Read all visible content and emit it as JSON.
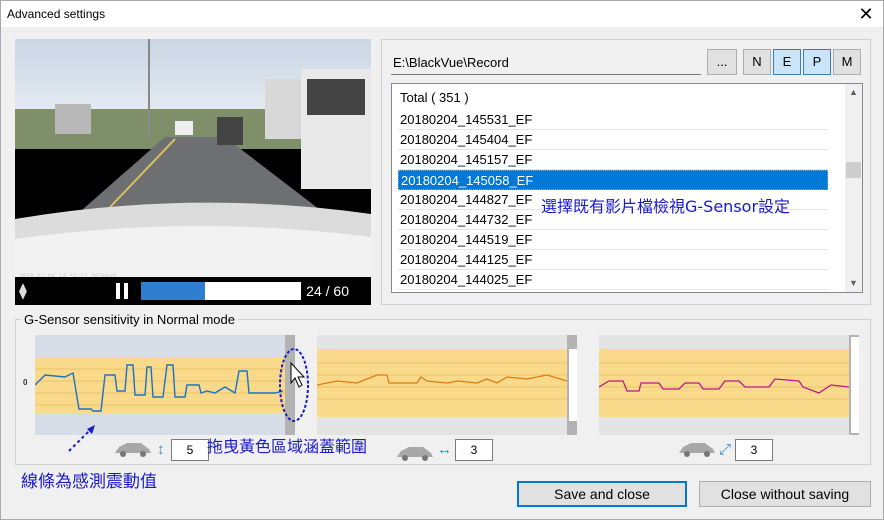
{
  "window": {
    "title": "Advanced settings",
    "close_glyph": "✕"
  },
  "video": {
    "counter": "24 / 60",
    "progress_fraction": 0.4,
    "timestamp_overlay": "2018-02-04 14:51:23  103km/h"
  },
  "toolbar": {
    "path_value": "E:\\BlackVue\\Record",
    "browse_label": "...",
    "filters": [
      {
        "label": "N",
        "selected": false
      },
      {
        "label": "E",
        "selected": true
      },
      {
        "label": "P",
        "selected": true
      },
      {
        "label": "M",
        "selected": false
      }
    ]
  },
  "file_list": {
    "header": "Total ( 351 )",
    "items": [
      "20180204_145531_EF",
      "20180204_145404_EF",
      "20180204_145157_EF",
      "20180204_145058_EF",
      "20180204_144827_EF",
      "20180204_144732_EF",
      "20180204_144519_EF",
      "20180204_144125_EF",
      "20180204_144025_EF"
    ],
    "selected_index": 3
  },
  "annotations": {
    "select_file": "選擇既有影片檔檢視G-Sensor設定",
    "drag_yellow": "拖曳黃色區域涵蓋範圍",
    "line_meaning": "線條為感測震動值"
  },
  "sensor": {
    "group_label": "G-Sensor sensitivity in Normal mode",
    "zero_label": "0",
    "axes": [
      {
        "value": "5",
        "line_color": "#1a73c8"
      },
      {
        "value": "3",
        "line_color": "#e07b10"
      },
      {
        "value": "3",
        "line_color": "#c0158c"
      }
    ]
  },
  "footer": {
    "save_label": "Save and close",
    "close_label": "Close without saving"
  },
  "colors": {
    "accent": "#0078d7",
    "band": "#f9d98a"
  }
}
